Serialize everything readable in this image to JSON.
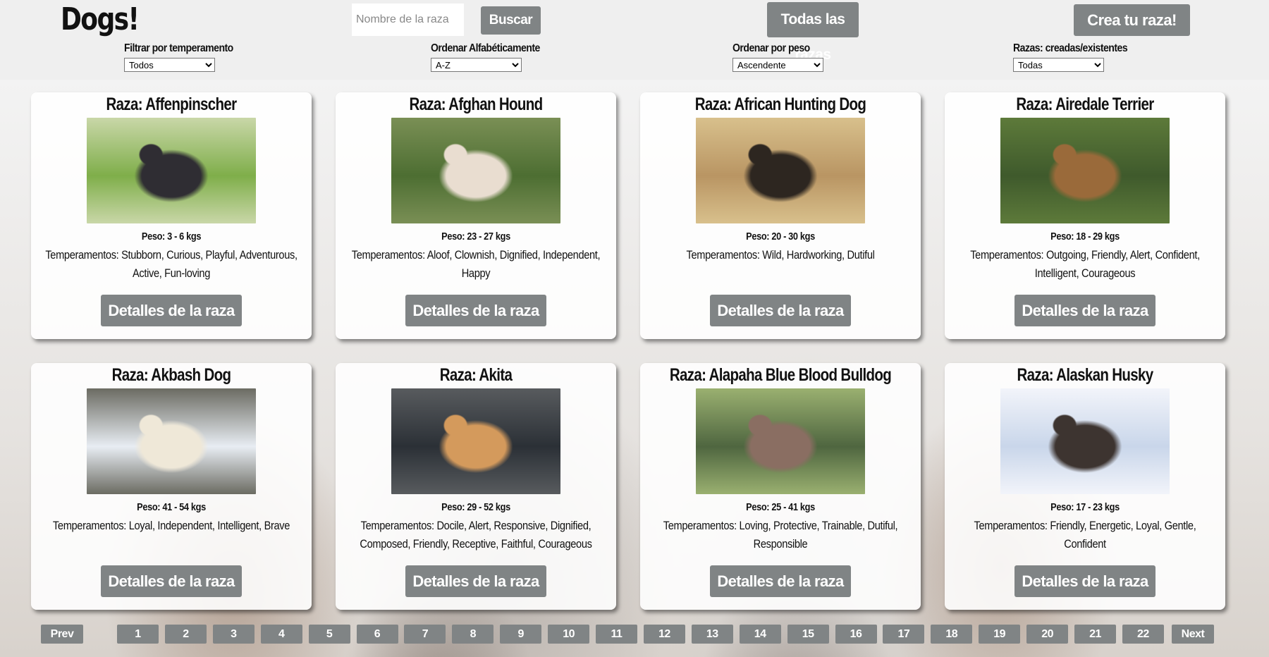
{
  "header": {
    "logo": "Dogs!",
    "search_placeholder": "Nombre de la raza",
    "search_button": "Buscar",
    "all_breeds_button": "Todas las razas",
    "create_button": "Crea tu raza!"
  },
  "filters": [
    {
      "label": "Filtrar por temperamento",
      "selected": "Todos"
    },
    {
      "label": "Ordenar Alfabéticamente",
      "selected": "A-Z"
    },
    {
      "label": "Ordenar por peso",
      "selected": "Ascendente"
    },
    {
      "label": "Razas: creadas/existentes",
      "selected": "Todas"
    }
  ],
  "cards": [
    {
      "title": "Raza: Affenpinscher",
      "weight": "Peso: 3 - 6 kgs",
      "temperaments": "Temperamentos: Stubborn, Curious, Playful, Adventurous, Active, Fun-loving",
      "button": "Detalles de la raza",
      "colors": [
        "#7fae4a",
        "#2f2d33",
        "#c9d7a8"
      ]
    },
    {
      "title": "Raza: Afghan Hound",
      "weight": "Peso: 23 - 27 kgs",
      "temperaments": "Temperamentos: Aloof, Clownish, Dignified, Independent, Happy",
      "button": "Detalles de la raza",
      "colors": [
        "#4d6e32",
        "#e9ddd0",
        "#7a8f55"
      ]
    },
    {
      "title": "Raza: African Hunting Dog",
      "weight": "Peso: 20 - 30 kgs",
      "temperaments": "Temperamentos: Wild, Hardworking, Dutiful",
      "button": "Detalles de la raza",
      "colors": [
        "#b99563",
        "#2d2620",
        "#d8c08c"
      ]
    },
    {
      "title": "Raza: Airedale Terrier",
      "weight": "Peso: 18 - 29 kgs",
      "temperaments": "Temperamentos: Outgoing, Friendly, Alert, Confident, Intelligent, Courageous",
      "button": "Detalles de la raza",
      "colors": [
        "#3f5a2c",
        "#9a6a3a",
        "#5d7a3a"
      ]
    },
    {
      "title": "Raza: Akbash Dog",
      "weight": "Peso: 41 - 54 kgs",
      "temperaments": "Temperamentos: Loyal, Independent, Intelligent, Brave",
      "button": "Detalles de la raza",
      "colors": [
        "#e8edf3",
        "#efe8d8",
        "#6b6b62"
      ]
    },
    {
      "title": "Raza: Akita",
      "weight": "Peso: 29 - 52 kgs",
      "temperaments": "Temperamentos: Docile, Alert, Responsive, Dignified, Composed, Friendly, Receptive, Faithful, Courageous",
      "button": "Detalles de la raza",
      "colors": [
        "#2b3036",
        "#d49a5c",
        "#585b5e"
      ]
    },
    {
      "title": "Raza: Alapaha Blue Blood Bulldog",
      "weight": "Peso: 25 - 41 kgs",
      "temperaments": "Temperamentos: Loving, Protective, Trainable, Dutiful, Responsible",
      "button": "Detalles de la raza",
      "colors": [
        "#4f6640",
        "#8a6e62",
        "#9ab070"
      ]
    },
    {
      "title": "Raza: Alaskan Husky",
      "weight": "Peso: 17 - 23 kgs",
      "temperaments": "Temperamentos: Friendly, Energetic, Loyal, Gentle, Confident",
      "button": "Detalles de la raza",
      "colors": [
        "#c9d6ea",
        "#3d3430",
        "#f2f4fa"
      ]
    }
  ],
  "pagination": {
    "prev": "Prev",
    "pages": [
      "1",
      "2",
      "3",
      "4",
      "5",
      "6",
      "7",
      "8",
      "9",
      "10",
      "11",
      "12",
      "13",
      "14",
      "15",
      "16",
      "17",
      "18",
      "19",
      "20",
      "21",
      "22"
    ],
    "next": "Next"
  }
}
